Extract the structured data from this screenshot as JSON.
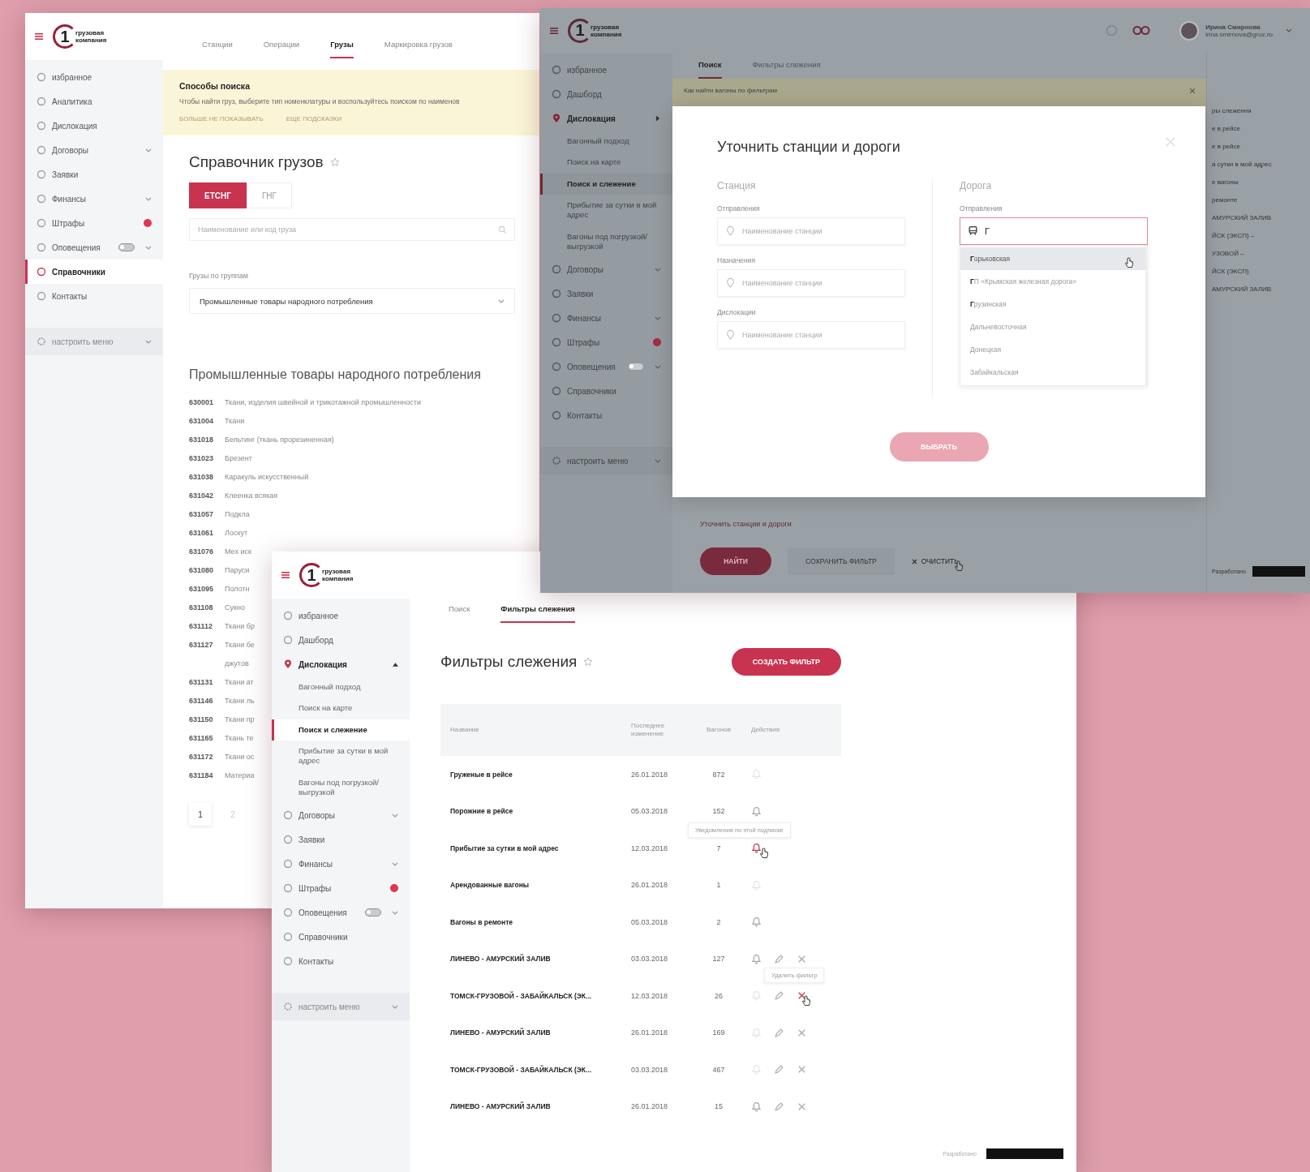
{
  "screen_a": {
    "logo": {
      "digit": "1",
      "line_1": "грузовая",
      "line_2": "компания"
    },
    "sidebar": {
      "items": [
        {
          "label": "избранное",
          "selected": false,
          "expandable": false
        },
        {
          "label": "Аналитика",
          "selected": false,
          "expandable": false
        },
        {
          "label": "Дислокация",
          "selected": false,
          "expandable": false
        },
        {
          "label": "Договоры",
          "selected": false,
          "expandable": true
        },
        {
          "label": "Заявки",
          "selected": false,
          "expandable": false
        },
        {
          "label": "Финансы",
          "selected": false,
          "expandable": true
        },
        {
          "label": "Штрафы",
          "selected": false,
          "expandable": false,
          "badge": true
        },
        {
          "label": "Оповещения",
          "selected": false,
          "expandable": true,
          "toggle": false
        },
        {
          "label": "Справочники",
          "selected": true,
          "expandable": false
        },
        {
          "label": "Контакты",
          "selected": false,
          "expandable": false
        }
      ],
      "settings": "настроить меню"
    },
    "tabs": [
      {
        "label": "Станции",
        "selected": false
      },
      {
        "label": "Операции",
        "selected": false
      },
      {
        "label": "Грузы",
        "selected": true
      },
      {
        "label": "Маркировка грузов",
        "selected": false
      }
    ],
    "notice": {
      "title": "Способы поиска",
      "text": "Чтобы найти груз, выберите тип номенклатуры и воспользуйтесь поиском по наименов",
      "links": [
        "БОЛЬШЕ НЕ ПОКАЗЫВАТЬ",
        "ЕЩЕ ПОДСКАЗКИ"
      ]
    },
    "title": "Справочник грузов",
    "segments": [
      {
        "label": "ЕТСНГ",
        "selected": true
      },
      {
        "label": "ГНГ",
        "selected": false
      }
    ],
    "search": {
      "placeholder": "Наименование или код груза"
    },
    "group_label": "Грузы по группам",
    "group_select": {
      "value": "Промышленные товары народного потребления"
    },
    "list_heading": "Промышленные товары народного потребления",
    "cargo": [
      {
        "code": "630001",
        "name": "Ткани, изделия швейной и трикотажной промышленности"
      },
      {
        "code": "631004",
        "name": "Ткани"
      },
      {
        "code": "631018",
        "name": "Бельтинг (ткань прорезиненная)"
      },
      {
        "code": "631023",
        "name": "Брезент"
      },
      {
        "code": "631038",
        "name": "Каракуль искусственный"
      },
      {
        "code": "631042",
        "name": "Клеенка всякая"
      },
      {
        "code": "631057",
        "name": "Подкла"
      },
      {
        "code": "631061",
        "name": "Лоскут"
      },
      {
        "code": "631076",
        "name": "Мех иск"
      },
      {
        "code": "631080",
        "name": "Паруси"
      },
      {
        "code": "631095",
        "name": "Полотн"
      },
      {
        "code": "631108",
        "name": "Сукно"
      },
      {
        "code": "631112",
        "name": "Ткани бр"
      },
      {
        "code": "631127",
        "name": "Ткани бе",
        "name_cont": "джутов"
      },
      {
        "code": "631131",
        "name": "Ткани ат"
      },
      {
        "code": "631146",
        "name": "Ткани ль"
      },
      {
        "code": "631150",
        "name": "Ткани пр"
      },
      {
        "code": "631165",
        "name": "Ткань те"
      },
      {
        "code": "631172",
        "name": "Ткани ос"
      },
      {
        "code": "631184",
        "name": "Материа"
      }
    ],
    "pages": [
      {
        "label": "1",
        "selected": true
      },
      {
        "label": "2",
        "selected": false
      }
    ]
  },
  "screen_b": {
    "logo": {
      "digit": "1",
      "line_1": "грузовая",
      "line_2": "компания"
    },
    "user": {
      "name": "Ирина Смирнова",
      "email": "irina.smirnova@gruz.ru"
    },
    "sidebar": {
      "items": [
        {
          "label": "избранное",
          "selected": false,
          "expandable": false
        },
        {
          "label": "Дашборд",
          "selected": false,
          "expandable": false
        },
        {
          "label": "Дислокация",
          "selected": false,
          "expandable": false,
          "expanded": true,
          "children": [
            {
              "label": "Вагонный подход",
              "selected": false
            },
            {
              "label": "Поиск на карте",
              "selected": false
            },
            {
              "label": "Поиск и слежение",
              "selected": true
            },
            {
              "label": "Прибытие за сутки в мой адрес",
              "selected": false
            },
            {
              "label": "Вагоны под погрузкой/выгрузкой",
              "selected": false
            }
          ]
        },
        {
          "label": "Договоры",
          "selected": false,
          "expandable": true
        },
        {
          "label": "Заявки",
          "selected": false,
          "expandable": false
        },
        {
          "label": "Финансы",
          "selected": false,
          "expandable": true
        },
        {
          "label": "Штрафы",
          "selected": false,
          "expandable": false,
          "badge": true
        },
        {
          "label": "Оповещения",
          "selected": false,
          "expandable": true,
          "toggle": false
        },
        {
          "label": "Справочники",
          "selected": false,
          "expandable": false
        },
        {
          "label": "Контакты",
          "selected": false,
          "expandable": false
        }
      ],
      "settings": "настроить меню"
    },
    "tabs": [
      {
        "label": "Поиск",
        "selected": true
      },
      {
        "label": "Фильтры слежения",
        "selected": false
      }
    ],
    "notice": {
      "text": "Как найти вагоны по фильтрам"
    },
    "refine_link": "Уточнить станции и дороги",
    "buttons": {
      "find": "НАЙТИ",
      "save": "СОХРАНИТЬ ФИЛЬТР",
      "clear": "ОЧИСТИТЬ"
    },
    "side_list": [
      "ры слежения",
      "е в рейсе",
      "е в рейсе",
      "а сутки в мой адрес",
      "е вагоны",
      "ремонте",
      "АМУРСКИЙ ЗАЛИВ",
      "ЙСК (ЭКСП) –",
      "УЗОВОЙ –",
      "ЙСК (ЭКСП)",
      "АМУРСКИЙ ЗАЛИВ"
    ],
    "credit": "Разработано",
    "modal": {
      "title": "Уточнить станции и дороги",
      "station": {
        "heading": "Станция",
        "fields": [
          {
            "label": "Отправления",
            "placeholder": "Наименование станции"
          },
          {
            "label": "Назначения",
            "placeholder": "Наименование станции"
          },
          {
            "label": "Дислокации",
            "placeholder": "Наименование станции"
          }
        ]
      },
      "road": {
        "heading": "Дорога",
        "label": "Отправления",
        "value": "Г",
        "focused": true,
        "options": [
          {
            "label": "**Г**орьковская",
            "selected": true
          },
          {
            "label": "**Г**П «Крымская железная дорога»",
            "selected": false
          },
          {
            "label": "**Г**рузинская",
            "selected": false
          },
          {
            "label": "Дальневосточная",
            "selected": false
          },
          {
            "label": "Донецкая",
            "selected": false
          },
          {
            "label": "Забайкальская",
            "selected": false
          }
        ]
      },
      "submit": {
        "label": "ВЫБРАТЬ",
        "disabled": true
      }
    }
  },
  "screen_c": {
    "logo": {
      "digit": "1",
      "line_1": "грузовая",
      "line_2": "компания"
    },
    "sidebar": {
      "items": [
        {
          "label": "избранное",
          "selected": false,
          "expandable": false
        },
        {
          "label": "Дашборд",
          "selected": false,
          "expandable": false
        },
        {
          "label": "Дислокация",
          "selected": false,
          "expandable": false,
          "expanded": true,
          "children": [
            {
              "label": "Вагонный подход",
              "selected": false
            },
            {
              "label": "Поиск на карте",
              "selected": false
            },
            {
              "label": "Поиск и слежение",
              "selected": true
            },
            {
              "label": "Прибытие за сутки в мой адрес",
              "selected": false
            },
            {
              "label": "Вагоны под погрузкой/выгрузкой",
              "selected": false
            }
          ]
        },
        {
          "label": "Договоры",
          "selected": false,
          "expandable": true
        },
        {
          "label": "Заявки",
          "selected": false,
          "expandable": false
        },
        {
          "label": "Финансы",
          "selected": false,
          "expandable": true
        },
        {
          "label": "Штрафы",
          "selected": false,
          "expandable": false,
          "badge": true
        },
        {
          "label": "Оповещения",
          "selected": false,
          "expandable": true,
          "toggle": false
        },
        {
          "label": "Справочники",
          "selected": false,
          "expandable": false
        },
        {
          "label": "Контакты",
          "selected": false,
          "expandable": false
        }
      ],
      "settings": "настроить меню"
    },
    "tabs": [
      {
        "label": "Поиск",
        "selected": false
      },
      {
        "label": "Фильтры слежения",
        "selected": true
      }
    ],
    "title": "Фильтры слежения",
    "create_button": "СОЗДАТЬ ФИЛЬТР",
    "table": {
      "columns": [
        "Название",
        "Последнее изменение",
        "Вагонов",
        "Действия"
      ],
      "rows": [
        {
          "name": "Груженые в рейсе",
          "date": "26.01.2018",
          "count": "872",
          "notify": false,
          "editable": false
        },
        {
          "name": "Порожние в рейсе",
          "date": "05.03.2018",
          "count": "152",
          "notify": true,
          "editable": false
        },
        {
          "name": "Прибытие за сутки в мой адрес",
          "date": "12.03.2018",
          "count": "7",
          "notify": true,
          "editable": false,
          "hover_notify": true,
          "tooltip": "Уведомления по этой подписке"
        },
        {
          "name": "Арендованные вагоны",
          "date": "26.01.2018",
          "count": "1",
          "notify": false,
          "editable": false
        },
        {
          "name": "Вагоны в ремонте",
          "date": "05.03.2018",
          "count": "2",
          "notify": true,
          "editable": false
        },
        {
          "name": "ЛИНЕВО - АМУРСКИЙ ЗАЛИВ",
          "date": "03.03.2018",
          "count": "127",
          "notify": true,
          "editable": true
        },
        {
          "name": "ТОМСК-ГРУЗОВОЙ - ЗАБАЙКАЛЬСК (ЭК...",
          "date": "12.03.2018",
          "count": "26",
          "notify": false,
          "editable": true,
          "hover_delete": true,
          "tooltip": "Удалить фильтр"
        },
        {
          "name": "ЛИНЕВО - АМУРСКИЙ ЗАЛИВ",
          "date": "26.01.2018",
          "count": "169",
          "notify": false,
          "editable": true
        },
        {
          "name": "ТОМСК-ГРУЗОВОЙ - ЗАБАЙКАЛЬСК (ЭК...",
          "date": "03.03.2018",
          "count": "467",
          "notify": false,
          "editable": true
        },
        {
          "name": "ЛИНЕВО - АМУРСКИЙ ЗАЛИВ",
          "date": "26.01.2018",
          "count": "15",
          "notify": true,
          "editable": true
        }
      ]
    },
    "credit": "Разработано"
  }
}
